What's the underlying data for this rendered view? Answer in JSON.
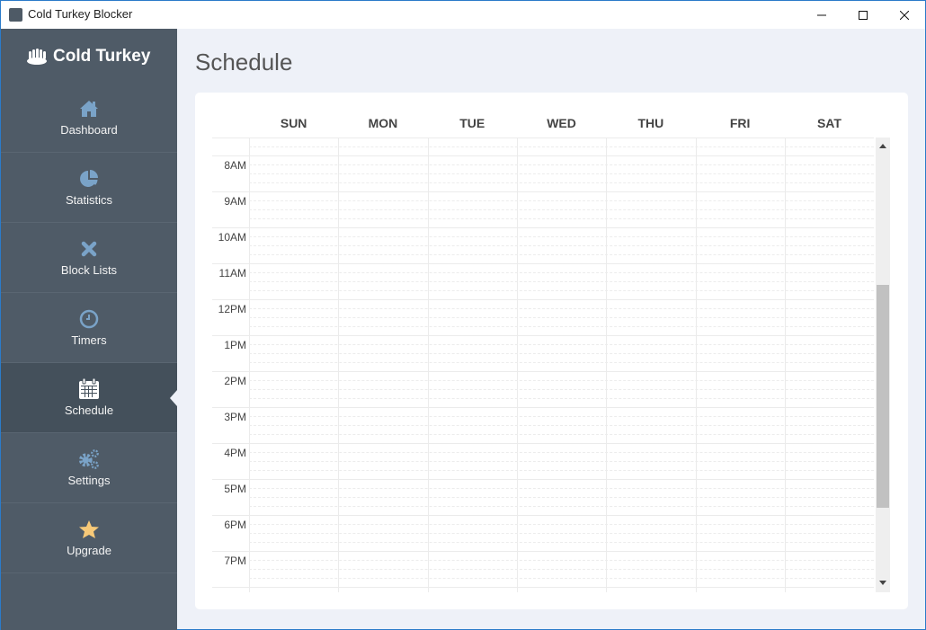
{
  "window": {
    "title": "Cold Turkey Blocker",
    "controls": {
      "minimize": "minimize",
      "maximize": "maximize",
      "close": "close"
    }
  },
  "sidebar": {
    "brand": "Cold Turkey",
    "items": [
      {
        "label": "Dashboard",
        "icon": "home-icon",
        "active": false
      },
      {
        "label": "Statistics",
        "icon": "pie-chart-icon",
        "active": false
      },
      {
        "label": "Block Lists",
        "icon": "x-icon",
        "active": false
      },
      {
        "label": "Timers",
        "icon": "clock-icon",
        "active": false
      },
      {
        "label": "Schedule",
        "icon": "calendar-icon",
        "active": true
      },
      {
        "label": "Settings",
        "icon": "gears-icon",
        "active": false
      },
      {
        "label": "Upgrade",
        "icon": "star-icon",
        "active": false
      }
    ]
  },
  "colors": {
    "sidebar_bg": "#4f5b67",
    "sidebar_active": "#44505b",
    "icon_blue": "#7aa3c8",
    "star": "#f7c978",
    "content_bg": "#eef1f8"
  },
  "main": {
    "title": "Schedule",
    "days": [
      "SUN",
      "MON",
      "TUE",
      "WED",
      "THU",
      "FRI",
      "SAT"
    ],
    "hours": [
      "8AM",
      "9AM",
      "10AM",
      "11AM",
      "12PM",
      "1PM",
      "2PM",
      "3PM",
      "4PM",
      "5PM",
      "6PM",
      "7PM"
    ]
  }
}
